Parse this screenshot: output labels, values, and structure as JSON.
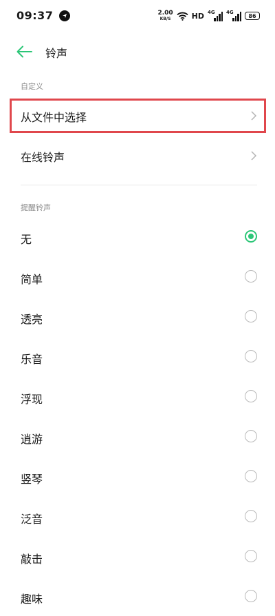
{
  "status_bar": {
    "time": "09:37",
    "net_speed_value": "2.00",
    "net_speed_unit": "KB/S",
    "hd_label": "HD",
    "signal_1_label": "4G",
    "signal_2_label": "4G",
    "battery": "86"
  },
  "header": {
    "title": "铃声"
  },
  "custom_section": {
    "label": "自定义",
    "items": [
      {
        "label": "从文件中选择"
      },
      {
        "label": "在线铃声"
      }
    ]
  },
  "notification_section": {
    "label": "提醒铃声",
    "selected_index": 0,
    "items": [
      {
        "label": "无"
      },
      {
        "label": "简单"
      },
      {
        "label": "透亮"
      },
      {
        "label": "乐音"
      },
      {
        "label": "浮现"
      },
      {
        "label": "逍游"
      },
      {
        "label": "竖琴"
      },
      {
        "label": "泛音"
      },
      {
        "label": "敲击"
      },
      {
        "label": "趣味"
      }
    ]
  },
  "colors": {
    "accent": "#2cc677",
    "highlight": "#e0474c"
  }
}
